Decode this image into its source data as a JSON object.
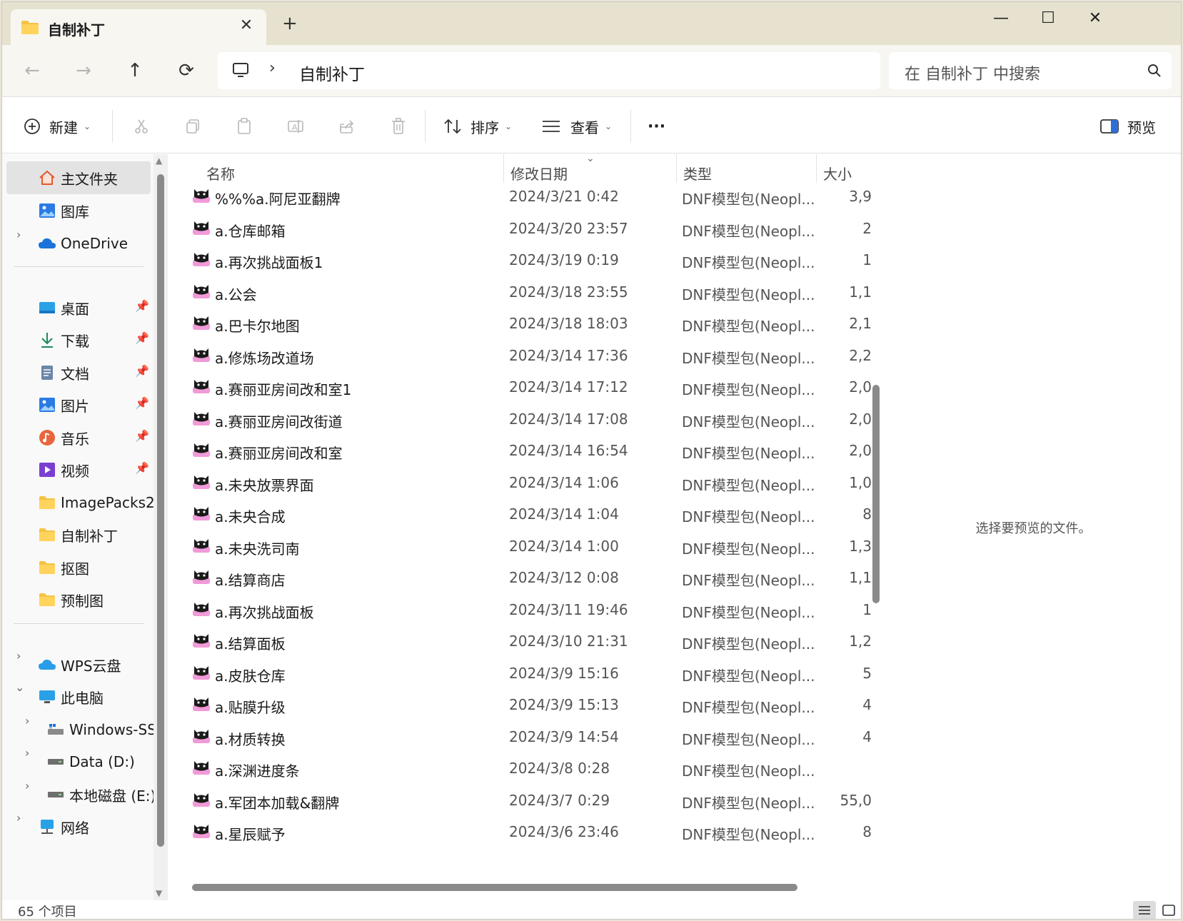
{
  "tab": {
    "title": "自制补丁",
    "close": "✕",
    "add": "+"
  },
  "window_controls": {
    "minimize": "—",
    "maximize": "☐",
    "close": "✕"
  },
  "nav": {
    "back": "←",
    "forward": "→",
    "up": "↑",
    "refresh": "⟳"
  },
  "address": {
    "separator": "›",
    "path": "自制补丁"
  },
  "search": {
    "placeholder": "在 自制补丁 中搜索"
  },
  "toolbar": {
    "new_label": "新建",
    "sort_label": "排序",
    "view_label": "查看",
    "more_label": "···",
    "preview_label": "预览"
  },
  "sidebar": {
    "home": "主文件夹",
    "gallery": "图库",
    "onedrive": "OneDrive",
    "quick": [
      {
        "label": "桌面",
        "icon": "desktop-icon"
      },
      {
        "label": "下载",
        "icon": "download-icon"
      },
      {
        "label": "文档",
        "icon": "document-icon"
      },
      {
        "label": "图片",
        "icon": "pictures-icon"
      },
      {
        "label": "音乐",
        "icon": "music-icon"
      },
      {
        "label": "视频",
        "icon": "video-icon"
      },
      {
        "label": "ImagePacks2",
        "icon": "folder-icon"
      },
      {
        "label": "自制补丁",
        "icon": "folder-icon"
      },
      {
        "label": "抠图",
        "icon": "folder-icon"
      },
      {
        "label": "预制图",
        "icon": "folder-icon"
      }
    ],
    "wps": "WPS云盘",
    "thispc": "此电脑",
    "drives": [
      "Windows-SSD",
      "Data (D:)",
      "本地磁盘 (E:)"
    ],
    "network": "网络"
  },
  "columns": {
    "name": "名称",
    "date": "修改日期",
    "type": "类型",
    "size": "大小"
  },
  "files": [
    {
      "name": "%%%a.阿尼亚翻牌",
      "date": "2024/3/21 0:42",
      "type": "DNF模型包(Neopl...",
      "size": "3,9"
    },
    {
      "name": "a.仓库邮箱",
      "date": "2024/3/20 23:57",
      "type": "DNF模型包(Neopl...",
      "size": "2"
    },
    {
      "name": "a.再次挑战面板1",
      "date": "2024/3/19 0:19",
      "type": "DNF模型包(Neopl...",
      "size": "1"
    },
    {
      "name": "a.公会",
      "date": "2024/3/18 23:55",
      "type": "DNF模型包(Neopl...",
      "size": "1,1"
    },
    {
      "name": "a.巴卡尔地图",
      "date": "2024/3/18 18:03",
      "type": "DNF模型包(Neopl...",
      "size": "2,1"
    },
    {
      "name": "a.修炼场改道场",
      "date": "2024/3/14 17:36",
      "type": "DNF模型包(Neopl...",
      "size": "2,2"
    },
    {
      "name": "a.赛丽亚房间改和室1",
      "date": "2024/3/14 17:12",
      "type": "DNF模型包(Neopl...",
      "size": "2,0"
    },
    {
      "name": "a.赛丽亚房间改街道",
      "date": "2024/3/14 17:08",
      "type": "DNF模型包(Neopl...",
      "size": "2,0"
    },
    {
      "name": "a.赛丽亚房间改和室",
      "date": "2024/3/14 16:54",
      "type": "DNF模型包(Neopl...",
      "size": "2,0"
    },
    {
      "name": "a.未央放票界面",
      "date": "2024/3/14 1:06",
      "type": "DNF模型包(Neopl...",
      "size": "1,0"
    },
    {
      "name": "a.未央合成",
      "date": "2024/3/14 1:04",
      "type": "DNF模型包(Neopl...",
      "size": "8"
    },
    {
      "name": "a.未央洗司南",
      "date": "2024/3/14 1:00",
      "type": "DNF模型包(Neopl...",
      "size": "1,3"
    },
    {
      "name": "a.结算商店",
      "date": "2024/3/12 0:08",
      "type": "DNF模型包(Neopl...",
      "size": "1,1"
    },
    {
      "name": "a.再次挑战面板",
      "date": "2024/3/11 19:46",
      "type": "DNF模型包(Neopl...",
      "size": "1"
    },
    {
      "name": "a.结算面板",
      "date": "2024/3/10 21:31",
      "type": "DNF模型包(Neopl...",
      "size": "1,2"
    },
    {
      "name": "a.皮肤仓库",
      "date": "2024/3/9 15:16",
      "type": "DNF模型包(Neopl...",
      "size": "5"
    },
    {
      "name": "a.贴膜升级",
      "date": "2024/3/9 15:13",
      "type": "DNF模型包(Neopl...",
      "size": "4"
    },
    {
      "name": "a.材质转换",
      "date": "2024/3/9 14:54",
      "type": "DNF模型包(Neopl...",
      "size": "4"
    },
    {
      "name": "a.深渊进度条",
      "date": "2024/3/8 0:28",
      "type": "DNF模型包(Neopl...",
      "size": ""
    },
    {
      "name": "a.军团本加载&翻牌",
      "date": "2024/3/7 0:29",
      "type": "DNF模型包(Neopl...",
      "size": "55,0"
    },
    {
      "name": "a.星辰赋予",
      "date": "2024/3/6 23:46",
      "type": "DNF模型包(Neopl...",
      "size": "8"
    }
  ],
  "preview": {
    "empty_text": "选择要预览的文件。"
  },
  "status": {
    "count": "65 个项目"
  }
}
